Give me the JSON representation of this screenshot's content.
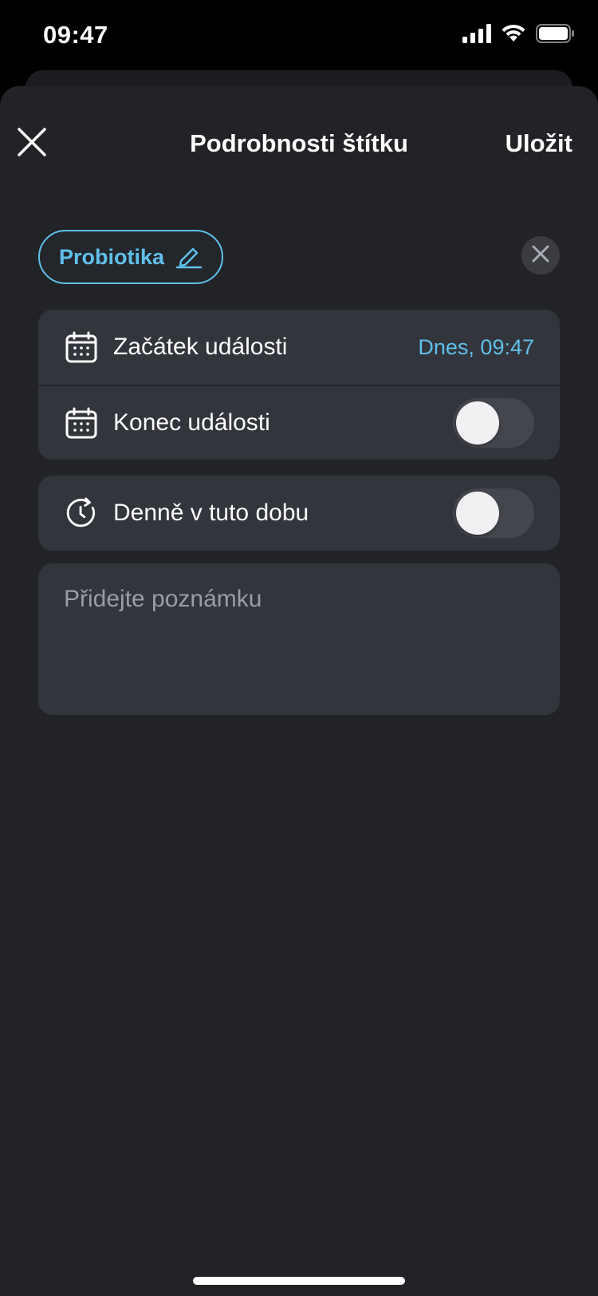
{
  "status_bar": {
    "time": "09:47",
    "icons": [
      "signal-icon",
      "wifi-icon",
      "battery-icon"
    ]
  },
  "header": {
    "title": "Podrobnosti štítku",
    "save_label": "Uložit",
    "close_icon": "close-icon"
  },
  "tag": {
    "label": "Probiotika",
    "edit_icon": "pencil-icon",
    "remove_icon": "close-icon"
  },
  "event_group": {
    "start": {
      "label": "Začátek události",
      "value": "Dnes, 09:47",
      "icon": "calendar-icon"
    },
    "end": {
      "label": "Konec události",
      "icon": "calendar-icon",
      "enabled": false
    }
  },
  "daily_group": {
    "label": "Denně v tuto dobu",
    "icon": "clock-repeat-icon",
    "enabled": false
  },
  "note": {
    "placeholder": "Přidejte poznámku",
    "value": ""
  },
  "colors": {
    "accent": "#5fc0ea",
    "background": "#222326",
    "card": "#33353c"
  }
}
